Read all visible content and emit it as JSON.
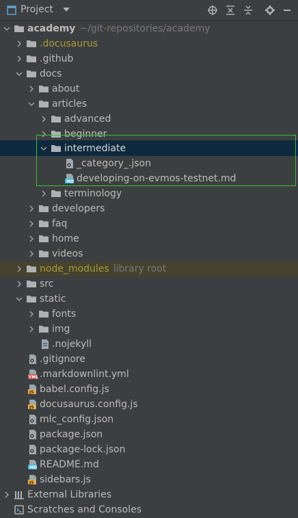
{
  "header": {
    "title": "Project",
    "buttons": [
      "locate-icon",
      "expand-all-icon",
      "collapse-all-icon",
      "settings-icon",
      "hide-icon"
    ]
  },
  "tree": {
    "root": {
      "label": "academy",
      "hint": "~/git-repositories/academy"
    },
    "items": {
      "docusaurus": ".docusaurus",
      "github": ".github",
      "docs": "docs",
      "about": "about",
      "articles": "articles",
      "advanced": "advanced",
      "beginner": "beginner",
      "intermediate": "intermediate",
      "category_json": "_category_.json",
      "developing_md": "developing-on-evmos-testnet.md",
      "terminology": "terminology",
      "developers": "developers",
      "faq": "faq",
      "home": "home",
      "videos": "videos",
      "node_modules": "node_modules",
      "node_modules_hint": "library root",
      "src": "src",
      "static": "static",
      "fonts": "fonts",
      "img": "img",
      "nojekyll": ".nojekyll",
      "gitignore": ".gitignore",
      "markdownlint": ".markdownlint.yml",
      "babel": "babel.config.js",
      "docusaurus_config": "docusaurus.config.js",
      "mlc_config": "mlc_config.json",
      "package_json": "package.json",
      "package_lock": "package-lock.json",
      "readme": "README.md",
      "sidebars": "sidebars.js",
      "external_libraries": "External Libraries",
      "scratches": "Scratches and Consoles"
    },
    "badges": {
      "yml": "YML",
      "js": "JS",
      "md": "MD"
    }
  },
  "colors": {
    "background": "#3c3f41",
    "selection": "#0d293e",
    "highlight_border": "#2bcb2b",
    "folder": "#afb1b3",
    "excluded_text": "#a89b34"
  }
}
